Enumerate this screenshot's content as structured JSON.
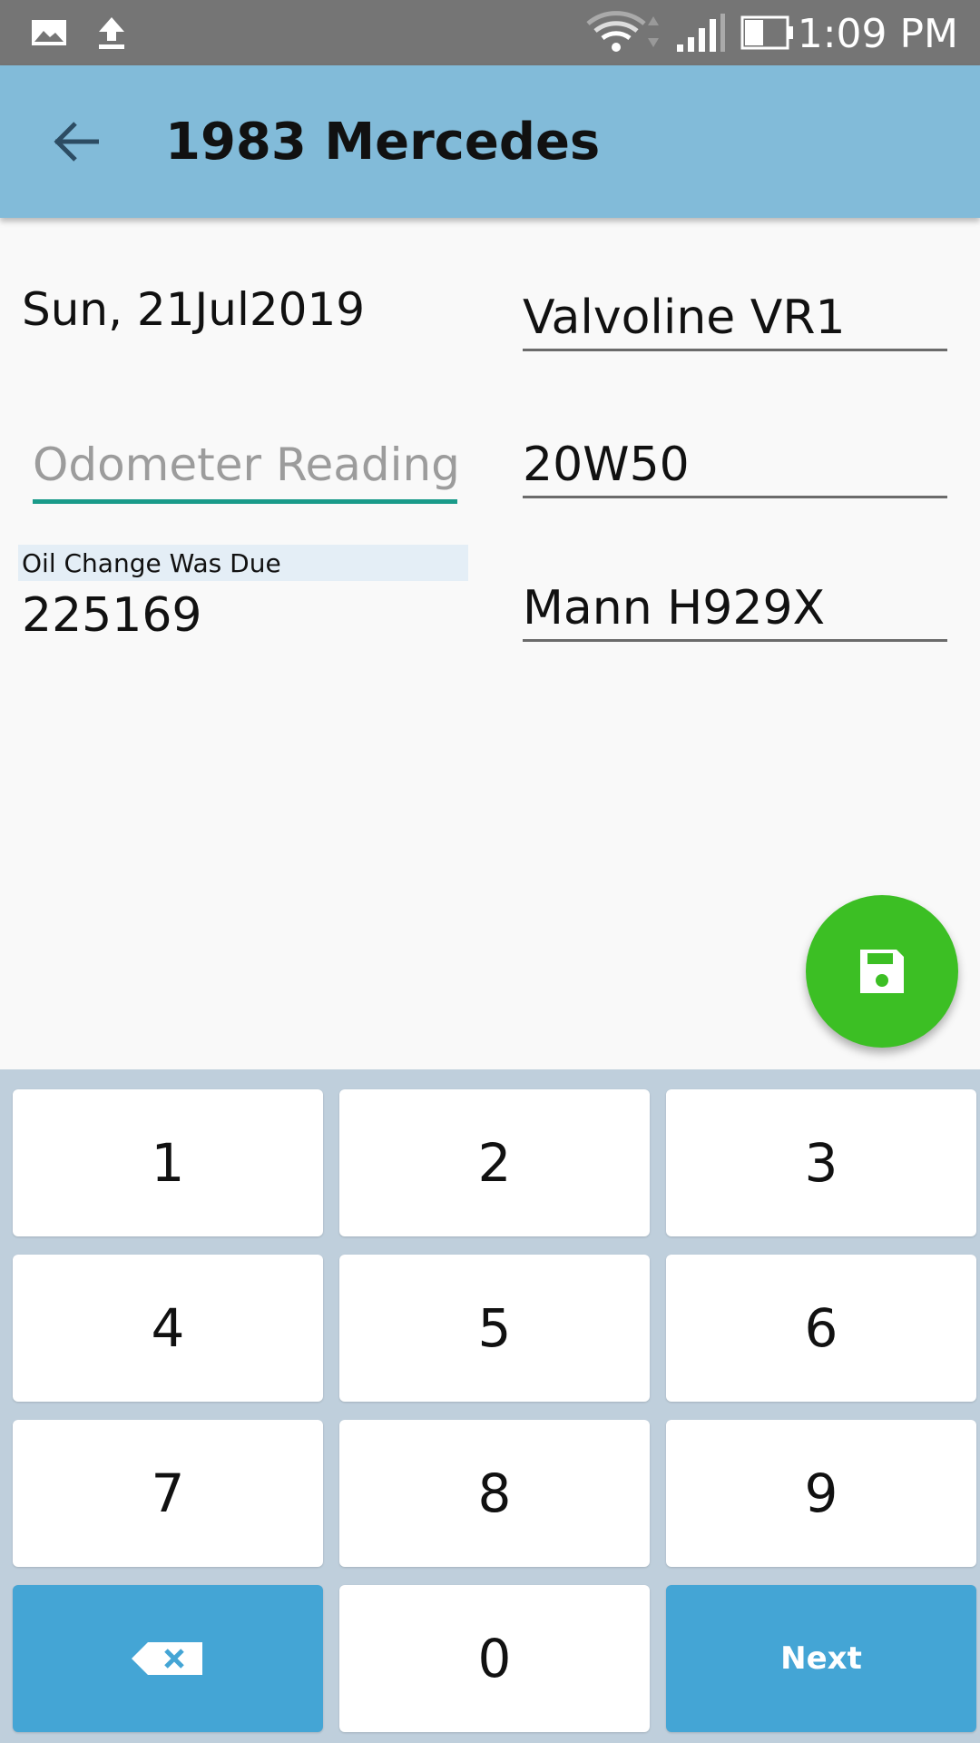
{
  "status_bar": {
    "time": "1:09 PM",
    "icons": [
      "image-icon",
      "upload-icon",
      "wifi-icon",
      "signal-icon",
      "battery-icon"
    ]
  },
  "app_bar": {
    "title": "1983 Mercedes",
    "back_icon": "back-arrow-icon",
    "color": "#82bbd9"
  },
  "form": {
    "date": "Sun, 21Jul2019",
    "oil_brand": "Valvoline VR1",
    "oil_grade": "20W50",
    "filter": "Mann H929X",
    "odometer_placeholder": "Odometer Reading",
    "due_label": "Oil Change Was Due",
    "due_value": "225169"
  },
  "fab": {
    "icon": "save-icon",
    "color": "#3cbf24"
  },
  "keypad": {
    "keys": [
      "1",
      "2",
      "3",
      "4",
      "5",
      "6",
      "7",
      "8",
      "9",
      "",
      "0",
      "Next"
    ],
    "backspace_icon": "backspace-icon",
    "next_label": "Next",
    "action_color": "#44a5d5"
  }
}
